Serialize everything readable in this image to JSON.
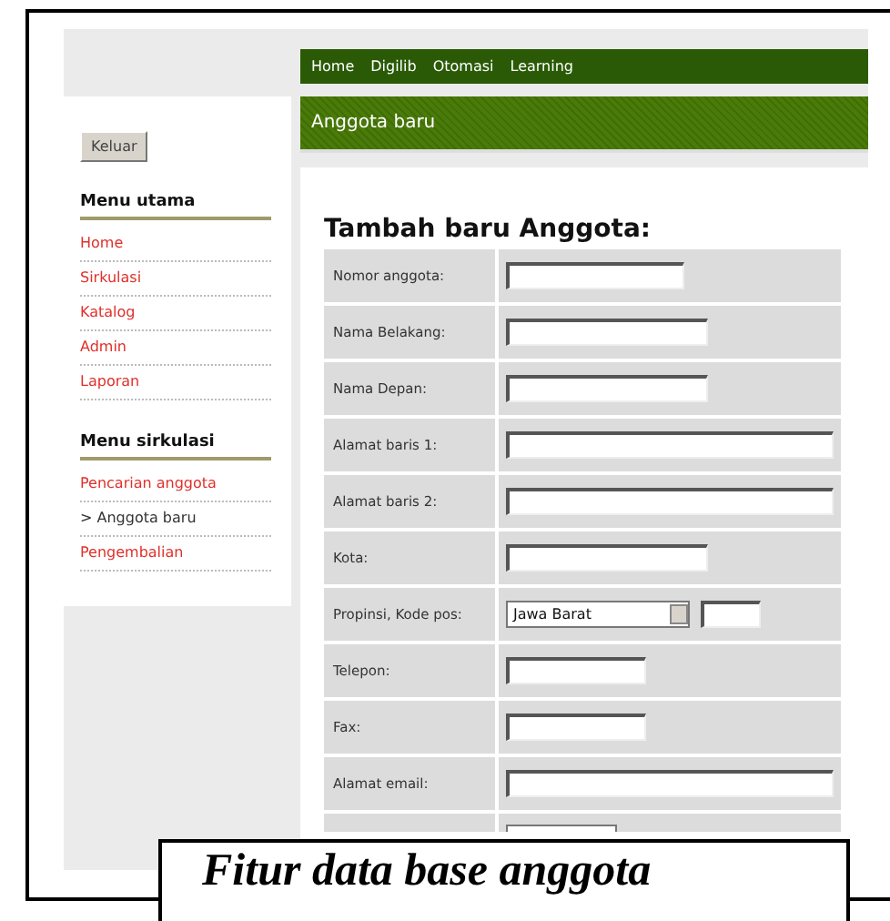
{
  "nav": [
    {
      "label": "Home"
    },
    {
      "label": "Digilib"
    },
    {
      "label": "Otomasi"
    },
    {
      "label": "Learning"
    }
  ],
  "sidebar": {
    "logout_button": "Keluar",
    "sections": [
      {
        "title": "Menu utama",
        "items": [
          {
            "label": "Home",
            "selected": false
          },
          {
            "label": "Sirkulasi",
            "selected": false
          },
          {
            "label": "Katalog",
            "selected": false
          },
          {
            "label": "Admin",
            "selected": false
          },
          {
            "label": "Laporan",
            "selected": false
          }
        ]
      },
      {
        "title": "Menu sirkulasi",
        "items": [
          {
            "label": "Pencarian anggota",
            "selected": false
          },
          {
            "label": "> Anggota baru",
            "selected": true
          },
          {
            "label": "Pengembalian",
            "selected": false
          }
        ]
      }
    ]
  },
  "page_header": "Anggota baru",
  "form": {
    "title": "Tambah baru Anggota:",
    "rows": [
      {
        "label": "Nomor anggota:",
        "fields": [
          {
            "kind": "text"
          }
        ]
      },
      {
        "label": "Nama Belakang:",
        "fields": [
          {
            "kind": "text"
          }
        ]
      },
      {
        "label": "Nama Depan:",
        "fields": [
          {
            "kind": "text"
          }
        ]
      },
      {
        "label": "Alamat baris 1:",
        "fields": [
          {
            "kind": "text"
          }
        ]
      },
      {
        "label": "Alamat baris 2:",
        "fields": [
          {
            "kind": "text"
          }
        ]
      },
      {
        "label": "Kota:",
        "fields": [
          {
            "kind": "text"
          }
        ]
      },
      {
        "label": "Propinsi, Kode pos:",
        "fields": [
          {
            "kind": "select",
            "value": "Jawa Barat"
          },
          {
            "kind": "text"
          }
        ]
      },
      {
        "label": "Telepon:",
        "fields": [
          {
            "kind": "text"
          }
        ]
      },
      {
        "label": "Fax:",
        "fields": [
          {
            "kind": "text"
          }
        ]
      },
      {
        "label": "Alamat email:",
        "fields": [
          {
            "kind": "text"
          }
        ]
      },
      {
        "fields": [
          {
            "kind": "select"
          }
        ]
      }
    ]
  },
  "caption": "Fitur data base anggota"
}
